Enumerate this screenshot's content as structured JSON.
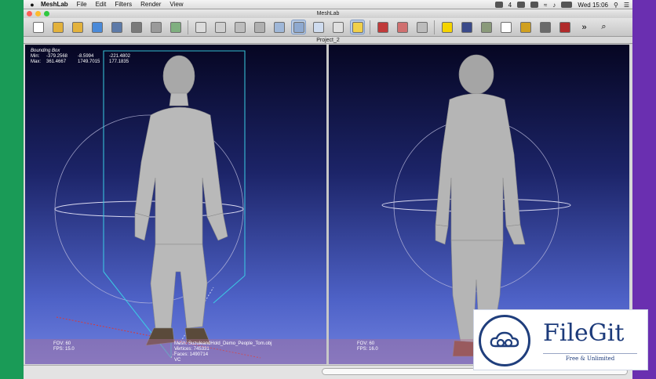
{
  "menubar": {
    "apple_icon": "",
    "app_name": "MeshLab",
    "items": [
      "File",
      "Edit",
      "Filters",
      "Render",
      "View"
    ],
    "status": {
      "badge": "4",
      "clock": "Wed 15:06"
    }
  },
  "window": {
    "title": "MeshLab"
  },
  "document": {
    "title": "Project_2"
  },
  "toolbar": {
    "buttons": [
      {
        "name": "new-icon",
        "color": "#ffffff"
      },
      {
        "name": "open-icon",
        "color": "#e3b23c"
      },
      {
        "name": "open-project-icon",
        "color": "#e3b23c"
      },
      {
        "name": "reload-icon",
        "color": "#4a8ad9"
      },
      {
        "name": "import-icon",
        "color": "#5d7aa8"
      },
      {
        "name": "snapshot-icon",
        "color": "#7a7a7a"
      },
      {
        "name": "layers-icon",
        "color": "#9a9a9a"
      },
      {
        "name": "globe-icon",
        "color": "#7faf7f"
      },
      {
        "name": "bbox-icon",
        "color": "#dcdcdc"
      },
      {
        "name": "points-icon",
        "color": "#cfcfcf"
      },
      {
        "name": "wireframe-icon",
        "color": "#bdbdbd"
      },
      {
        "name": "hidden-lines-icon",
        "color": "#b0b0b0"
      },
      {
        "name": "flat-lines-icon",
        "color": "#9fb7d8"
      },
      {
        "name": "flat-icon",
        "color": "#8ea9d0",
        "selected": true
      },
      {
        "name": "smooth-icon",
        "color": "#cfdcef"
      },
      {
        "name": "texture-icon",
        "color": "#e0e0e0"
      },
      {
        "name": "light-icon",
        "color": "#f0d04a",
        "selected": true
      },
      {
        "name": "select-faces-icon",
        "color": "#c03a3a"
      },
      {
        "name": "select-vertices-icon",
        "color": "#d07070"
      },
      {
        "name": "transform-icon",
        "color": "#bcbcbc"
      },
      {
        "name": "annotate-icon",
        "color": "#f5d400"
      },
      {
        "name": "measure-icon",
        "color": "#3a4a8a"
      },
      {
        "name": "texture-map-icon",
        "color": "#8a9a7a"
      },
      {
        "name": "pdf-icon",
        "color": "#ffffff"
      },
      {
        "name": "paint-icon",
        "color": "#d0a020"
      },
      {
        "name": "brush-icon",
        "color": "#6a6a6a"
      },
      {
        "name": "logo-p-icon",
        "color": "#b02a2a"
      }
    ],
    "more_label": "»",
    "search_icon": "search-icon"
  },
  "viewport_left": {
    "bbox_title": "Bounding Box",
    "min_label": "Min:",
    "min": [
      "-379.2568",
      "-8.5994",
      "-221.4802"
    ],
    "max_label": "Max:",
    "max": [
      "361.4667",
      "1749.7015",
      "177.1835"
    ],
    "fov": "FOV: 60",
    "fps": "FPS:     15.0",
    "mesh": "Mesh: SuzuleandHold_Demo_People_Tom.obj",
    "vertices": "Vertices: 745331",
    "faces": "Faces: 1490714",
    "vc": "VC"
  },
  "viewport_right": {
    "fov": "FOV: 60",
    "fps": "FPS:     16.0"
  },
  "filegit": {
    "name": "FileGit",
    "tagline": "Free & Unlimited"
  }
}
